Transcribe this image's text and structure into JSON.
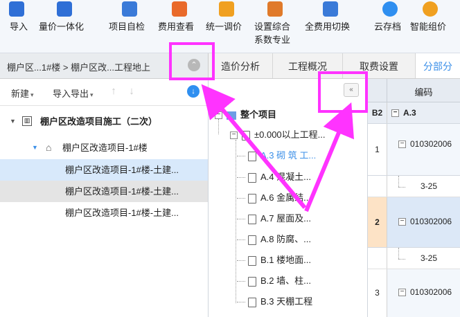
{
  "toolbar": {
    "items": [
      {
        "label": "导入",
        "label2": "",
        "icon": "import-icon"
      },
      {
        "label": "量价一体化",
        "label2": "",
        "icon": "price-integration-icon"
      },
      {
        "label": "项目自检",
        "label2": "",
        "icon": "self-check-icon"
      },
      {
        "label": "费用查看",
        "label2": "",
        "icon": "cost-view-icon"
      },
      {
        "label": "统一调价",
        "label2": "",
        "icon": "adjust-price-icon"
      },
      {
        "label": "设置综合",
        "label2": "系数专业",
        "icon": "coefficient-icon"
      },
      {
        "label": "全费用切换",
        "label2": "",
        "icon": "full-cost-switch-icon"
      },
      {
        "label": "云存档",
        "label2": "",
        "icon": "cloud-archive-icon"
      },
      {
        "label": "智能组价",
        "label2": "",
        "icon": "smart-pricing-icon"
      }
    ]
  },
  "tabbar": {
    "breadcrumb": "棚户区...1#楼 > 棚户区改...工程地上",
    "tabs": [
      "造价分析",
      "工程概况",
      "取费设置",
      "分部分"
    ]
  },
  "left_panel": {
    "new_label": "新建",
    "import_export_label": "导入导出",
    "project_root": "棚户区改造项目施工（二次）",
    "building": "棚户区改造项目-1#楼",
    "units": [
      "棚户区改造项目-1#楼-土建...",
      "棚户区改造项目-1#楼-土建...",
      "棚户区改造项目-1#楼-土建..."
    ]
  },
  "middle_panel": {
    "root": "整个项目",
    "group": "±0.000以上工程...",
    "items": [
      {
        "code": "A.3",
        "name": "砌 筑 工..."
      },
      {
        "code": "A.4",
        "name": "混凝土..."
      },
      {
        "code": "A.6",
        "name": "金属结..."
      },
      {
        "code": "A.7",
        "name": "屋面及..."
      },
      {
        "code": "A.8",
        "name": "防腐、..."
      },
      {
        "code": "B.1",
        "name": "楼地面..."
      },
      {
        "code": "B.2",
        "name": "墙、柱..."
      },
      {
        "code": "B.3",
        "name": "天棚工程"
      }
    ]
  },
  "grid": {
    "header": "编码",
    "section_num": "B2",
    "section_code": "A.3",
    "rows": [
      {
        "num": "1",
        "code": "010302006",
        "sub": "3-25"
      },
      {
        "num": "2",
        "code": "010302006",
        "sub": "3-25"
      },
      {
        "num": "3",
        "code": "010302006",
        "sub": ""
      }
    ]
  },
  "colors": {
    "accent": "#3b8fe8",
    "highlight": "#ff33ff",
    "selected_row": "#d8e9fb"
  }
}
